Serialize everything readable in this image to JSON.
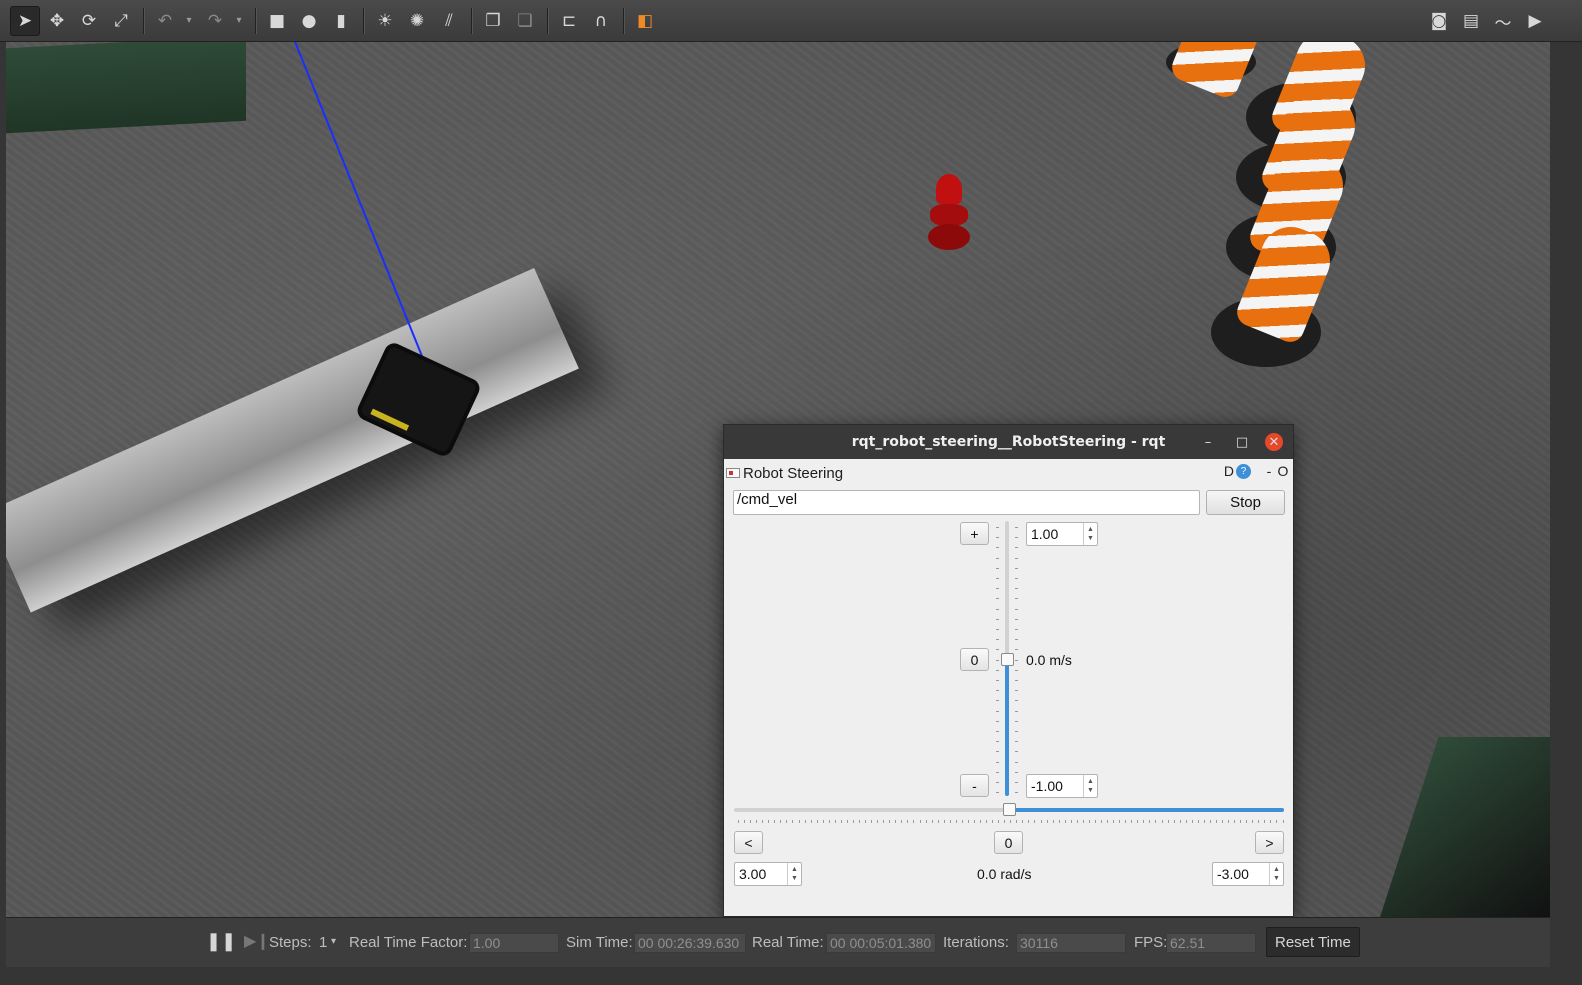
{
  "toolbar": {
    "icons": [
      "arrow-select-icon",
      "move-icon",
      "rotate-icon",
      "scale-icon",
      "undo-icon",
      "redo-icon",
      "box-icon",
      "sphere-icon",
      "cylinder-icon",
      "point-light-icon",
      "spot-light-icon",
      "directional-light-icon",
      "copy-icon",
      "paste-icon",
      "align-icon",
      "snap-magnet-icon",
      "view-angle-icon"
    ],
    "right_icons": [
      "screenshot-icon",
      "log-icon",
      "plot-icon",
      "video-record-icon"
    ]
  },
  "dialog": {
    "title": "rqt_robot_steering__RobotSteering - rqt",
    "plugin_title": "Robot Steering",
    "plugin_controls": {
      "d": "D",
      "help": "?",
      "dash": "-",
      "o": "O"
    },
    "topic_value": "/cmd_vel",
    "stop_label": "Stop",
    "linear": {
      "plus_label": "+",
      "zero_label": "0",
      "minus_label": "-",
      "max_value": "1.00",
      "min_value": "-1.00",
      "current_text": "0.0 m/s",
      "level_fraction": 0.5
    },
    "angular": {
      "left_label": "<",
      "zero_label": "0",
      "right_label": ">",
      "max_value": "3.00",
      "min_value": "-3.00",
      "current_text": "0.0 rad/s",
      "level_fraction": 0.5
    }
  },
  "statusbar": {
    "steps_label": "Steps:",
    "steps_value": "1",
    "rtf_label": "Real Time Factor:",
    "rtf_value": "1.00",
    "sim_time_label": "Sim Time:",
    "sim_time_value": "00 00:26:39.630",
    "real_time_label": "Real Time:",
    "real_time_value": "00 00:05:01.380",
    "iterations_label": "Iterations:",
    "iterations_value": "30116",
    "fps_label": "FPS:",
    "fps_value": "62.51",
    "reset_label": "Reset Time"
  }
}
